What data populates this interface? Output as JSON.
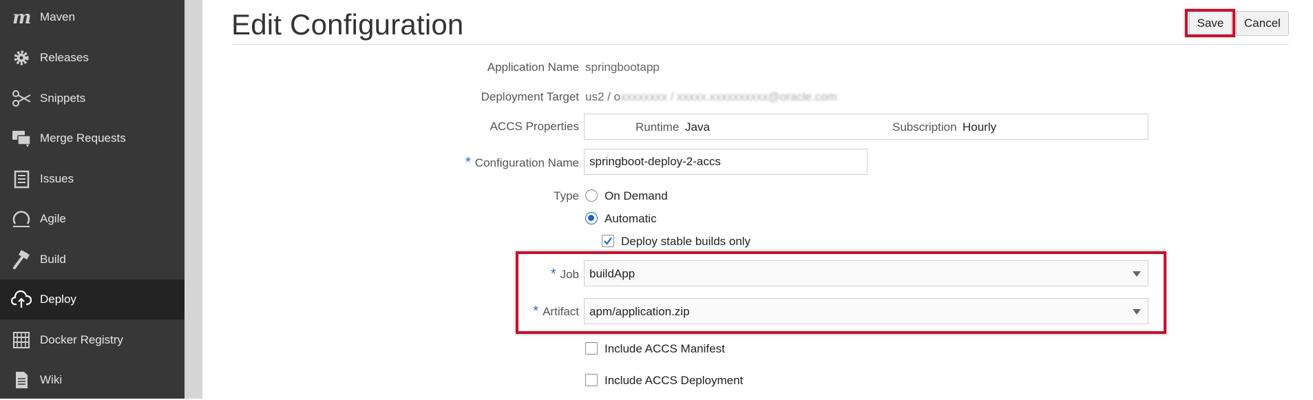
{
  "sidebar": {
    "items": [
      {
        "label": "Maven",
        "icon": "maven-icon"
      },
      {
        "label": "Releases",
        "icon": "gear-icon"
      },
      {
        "label": "Snippets",
        "icon": "scissors-icon"
      },
      {
        "label": "Merge Requests",
        "icon": "chat-bubbles-icon"
      },
      {
        "label": "Issues",
        "icon": "clipboard-icon"
      },
      {
        "label": "Agile",
        "icon": "refresh-circle-icon"
      },
      {
        "label": "Build",
        "icon": "hammer-icon"
      },
      {
        "label": "Deploy",
        "icon": "cloud-upload-icon",
        "active": true
      },
      {
        "label": "Docker Registry",
        "icon": "server-icon"
      },
      {
        "label": "Wiki",
        "icon": "document-icon"
      }
    ]
  },
  "page": {
    "title": "Edit Configuration",
    "save_label": "Save",
    "cancel_label": "Cancel"
  },
  "form": {
    "app_name_label": "Application Name",
    "app_name_value": "springbootapp",
    "target_label": "Deployment Target",
    "target_value_prefix": "us2 / o",
    "target_value_blurred": "xxxxxxxx / xxxxx.xxxxxxxxxx@oracle.com",
    "accs_label": "ACCS Properties",
    "runtime_label": "Runtime",
    "runtime_value": "Java",
    "subscription_label": "Subscription",
    "subscription_value": "Hourly",
    "config_name_label": "Configuration Name",
    "config_name_value": "springboot-deploy-2-accs",
    "type_label": "Type",
    "type_options": [
      {
        "label": "On Demand",
        "selected": false
      },
      {
        "label": "Automatic",
        "selected": true
      }
    ],
    "stable_label": "Deploy stable builds only",
    "stable_checked": true,
    "job_label": "Job",
    "job_value": "buildApp",
    "artifact_label": "Artifact",
    "artifact_value": "apm/application.zip",
    "manifest_label": "Include ACCS Manifest",
    "deployment_label": "Include ACCS Deployment",
    "required_marker": "*"
  },
  "colors": {
    "sidebar_bg": "#373737",
    "sidebar_active": "#232323",
    "highlight": "#c8102e",
    "accent": "#1f63c6",
    "required": "#2a6ebb"
  }
}
